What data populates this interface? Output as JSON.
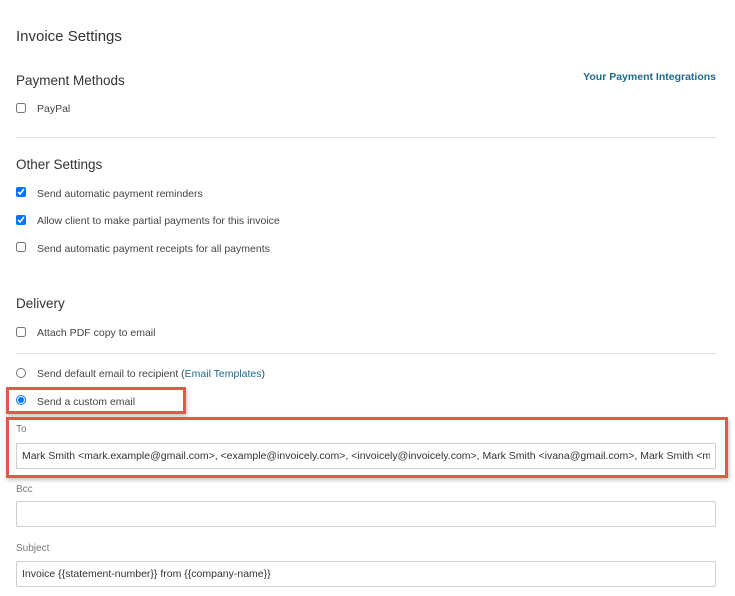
{
  "page": {
    "title": "Invoice Settings"
  },
  "payment_methods": {
    "heading": "Payment Methods",
    "integrations_link": "Your Payment Integrations",
    "options": [
      {
        "label": "PayPal",
        "checked": false
      }
    ]
  },
  "other_settings": {
    "heading": "Other Settings",
    "options": [
      {
        "label": "Send automatic payment reminders",
        "checked": true
      },
      {
        "label": "Allow client to make partial payments for this invoice",
        "checked": true
      },
      {
        "label": "Send automatic payment receipts for all payments",
        "checked": false
      }
    ]
  },
  "delivery": {
    "heading": "Delivery",
    "attach_pdf": {
      "label": "Attach PDF copy to email",
      "checked": false
    },
    "default_email": {
      "label_prefix": "Send default email to recipient (",
      "link": "Email Templates",
      "label_suffix": ")",
      "selected": false
    },
    "custom_email": {
      "label": "Send a custom email",
      "selected": true
    },
    "to": {
      "label": "To",
      "value": "Mark Smith <mark.example@gmail.com>, <example@invoicely.com>, <invoicely@invoicely.com>, Mark Smith <ivana@gmail.com>, Mark Smith <mark@example.com>"
    },
    "bcc": {
      "label": "Bcc",
      "value": ""
    },
    "subject": {
      "label": "Subject",
      "value": "Invoice {{statement-number}} from {{company-name}}"
    }
  },
  "colors": {
    "link": "#1f6a8f",
    "highlight": "#e4574b"
  }
}
